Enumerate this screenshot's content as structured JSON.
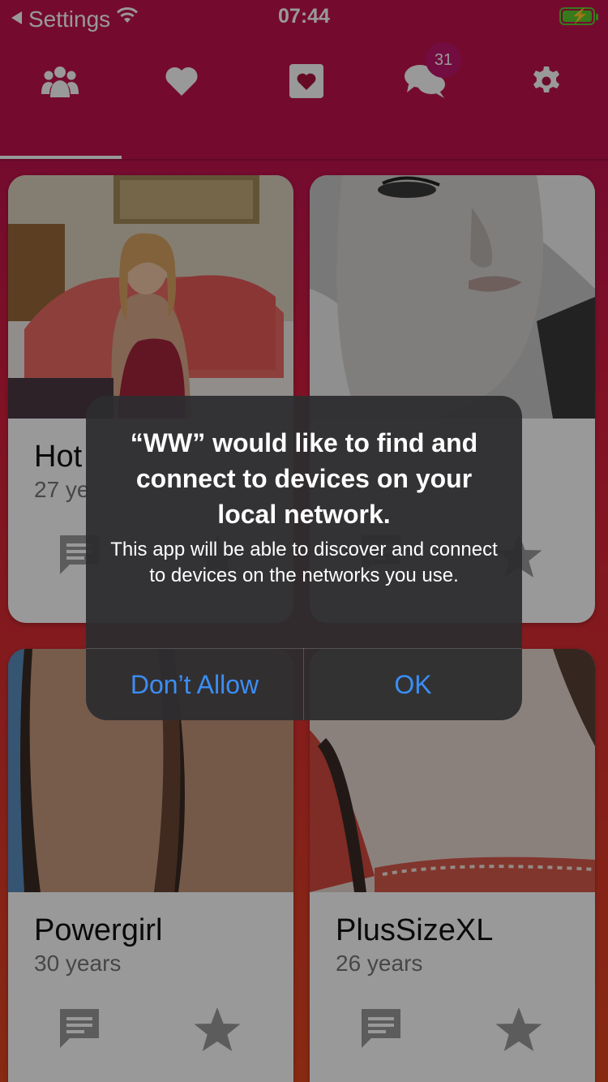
{
  "status_bar": {
    "back_label": "Settings",
    "time": "07:44"
  },
  "tabs": {
    "badge_count": "31",
    "icons": [
      "people-icon",
      "heart-icon",
      "heart-box-icon",
      "chat-icon",
      "gear-icon"
    ],
    "active_index": 0
  },
  "cards": [
    {
      "name": "Hot",
      "age": "27 ye"
    },
    {
      "name": "",
      "age": ""
    },
    {
      "name": "Powergirl",
      "age": "30 years"
    },
    {
      "name": "PlusSizeXL",
      "age": "26 years"
    }
  ],
  "alert": {
    "title": "“WW” would like to find and connect to devices on your local network.",
    "message": "This app will be able to discover and connect to devices on the networks you use.",
    "dont_allow": "Don’t Allow",
    "ok": "OK"
  },
  "colors": {
    "header": "#c2134f",
    "accent_link": "#3b8ef5",
    "badge": "#c0156c"
  }
}
